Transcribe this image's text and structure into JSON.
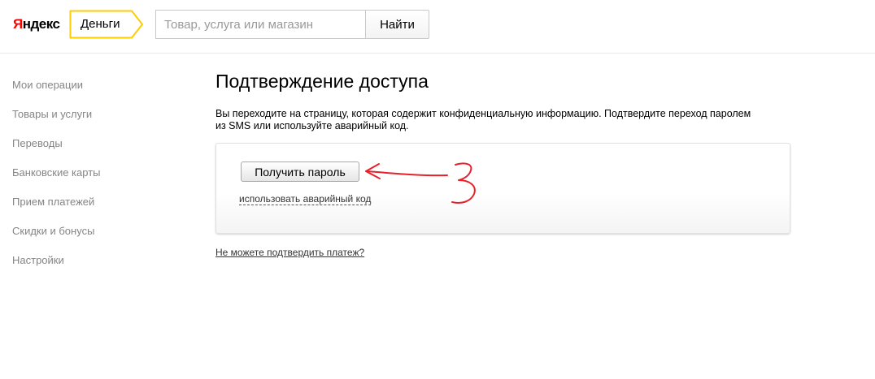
{
  "header": {
    "logo": {
      "first_letter": "Я",
      "rest": "ндекс"
    },
    "service_name": "Деньги",
    "search": {
      "placeholder": "Товар, услуга или магазин",
      "value": ""
    },
    "search_button_label": "Найти"
  },
  "sidebar": {
    "items": [
      {
        "label": "Мои операции"
      },
      {
        "label": "Товары и услуги"
      },
      {
        "label": "Переводы"
      },
      {
        "label": "Банковские карты"
      },
      {
        "label": "Прием платежей"
      },
      {
        "label": "Скидки и бонусы"
      },
      {
        "label": "Настройки"
      }
    ]
  },
  "main": {
    "title": "Подтверждение доступа",
    "description_line1": "Вы переходите на страницу, которая содержит конфиденциальную информацию. Подтвердите переход паролем",
    "description_line2": "из SMS или используйте аварийный код.",
    "card": {
      "get_password_label": "Получить пароль",
      "emergency_code_link": "использовать аварийный код"
    },
    "cant_confirm_link": "Не можете подтвердить платеж?"
  },
  "colors": {
    "brand_red": "#ff0000",
    "service_tag_border": "#ffcc00",
    "annotation": "#e8202a",
    "sidebar_text": "#858585"
  },
  "icons": {
    "annotation": "hand-drawn-arrow-and-number-3"
  }
}
